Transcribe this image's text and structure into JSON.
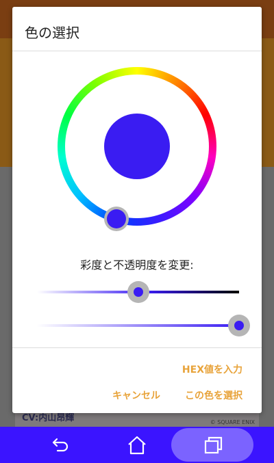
{
  "background": {
    "banner_text": "CV:内山昂輝",
    "banner_copyright": "© SQUARE ENIX"
  },
  "dialog": {
    "title": "色の選択",
    "selected_color": "#3a1cf2",
    "saturation_label": "彩度と不透明度を変更:",
    "saturation_value": 0.5,
    "opacity_value": 1.0,
    "hex_button": "HEX値を入力",
    "cancel_button": "キャンセル",
    "select_button": "この色を選択"
  },
  "navbar": {
    "color": "#3b14ff",
    "icons": [
      "back-icon",
      "home-icon",
      "recent-apps-icon"
    ]
  },
  "colors": {
    "accent": "#e8a33a"
  }
}
